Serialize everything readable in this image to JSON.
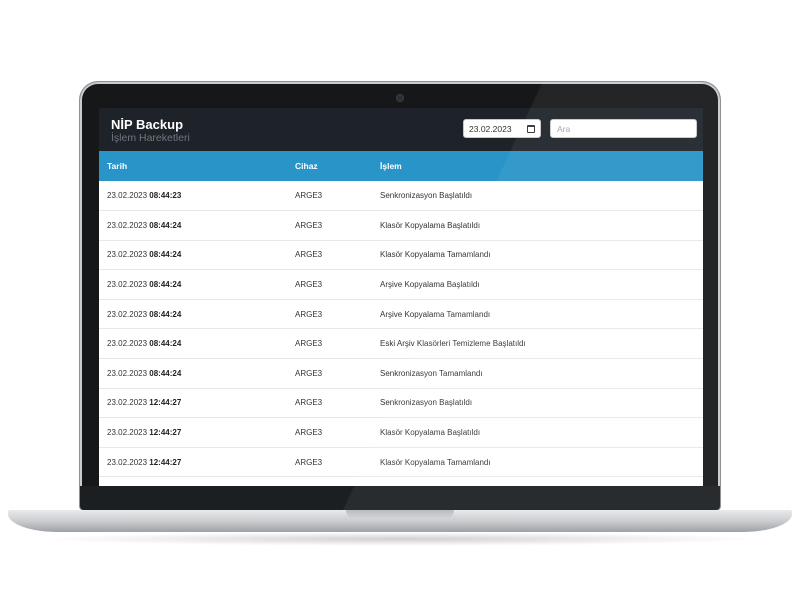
{
  "app": {
    "title": "NİP Backup",
    "subtitle": "İşlem Hareketleri"
  },
  "filters": {
    "date_value": "23.02.2023",
    "search_placeholder": "Ara"
  },
  "table": {
    "headers": {
      "date": "Tarih",
      "device": "Cihaz",
      "action": "İşlem"
    },
    "rows": [
      {
        "date": "23.02.2023",
        "time": "08:44:23",
        "device": "ARGE3",
        "action": "Senkronizasyon Başlatıldı"
      },
      {
        "date": "23.02.2023",
        "time": "08:44:24",
        "device": "ARGE3",
        "action": "Klasör Kopyalama Başlatıldı"
      },
      {
        "date": "23.02.2023",
        "time": "08:44:24",
        "device": "ARGE3",
        "action": "Klasör Kopyalama Tamamlandı"
      },
      {
        "date": "23.02.2023",
        "time": "08:44:24",
        "device": "ARGE3",
        "action": "Arşive Kopyalama Başlatıldı"
      },
      {
        "date": "23.02.2023",
        "time": "08:44:24",
        "device": "ARGE3",
        "action": "Arşive Kopyalama Tamamlandı"
      },
      {
        "date": "23.02.2023",
        "time": "08:44:24",
        "device": "ARGE3",
        "action": "Eski Arşiv Klasörleri Temizleme Başlatıldı"
      },
      {
        "date": "23.02.2023",
        "time": "08:44:24",
        "device": "ARGE3",
        "action": "Senkronizasyon Tamamlandı"
      },
      {
        "date": "23.02.2023",
        "time": "12:44:27",
        "device": "ARGE3",
        "action": "Senkronizasyon Başlatıldı"
      },
      {
        "date": "23.02.2023",
        "time": "12:44:27",
        "device": "ARGE3",
        "action": "Klasör Kopyalama Başlatıldı"
      },
      {
        "date": "23.02.2023",
        "time": "12:44:27",
        "device": "ARGE3",
        "action": "Klasör Kopyalama Tamamlandı"
      }
    ]
  },
  "colors": {
    "header_bg": "#1d2328",
    "table_header_bg": "#2894c7",
    "lid": "#151719"
  }
}
